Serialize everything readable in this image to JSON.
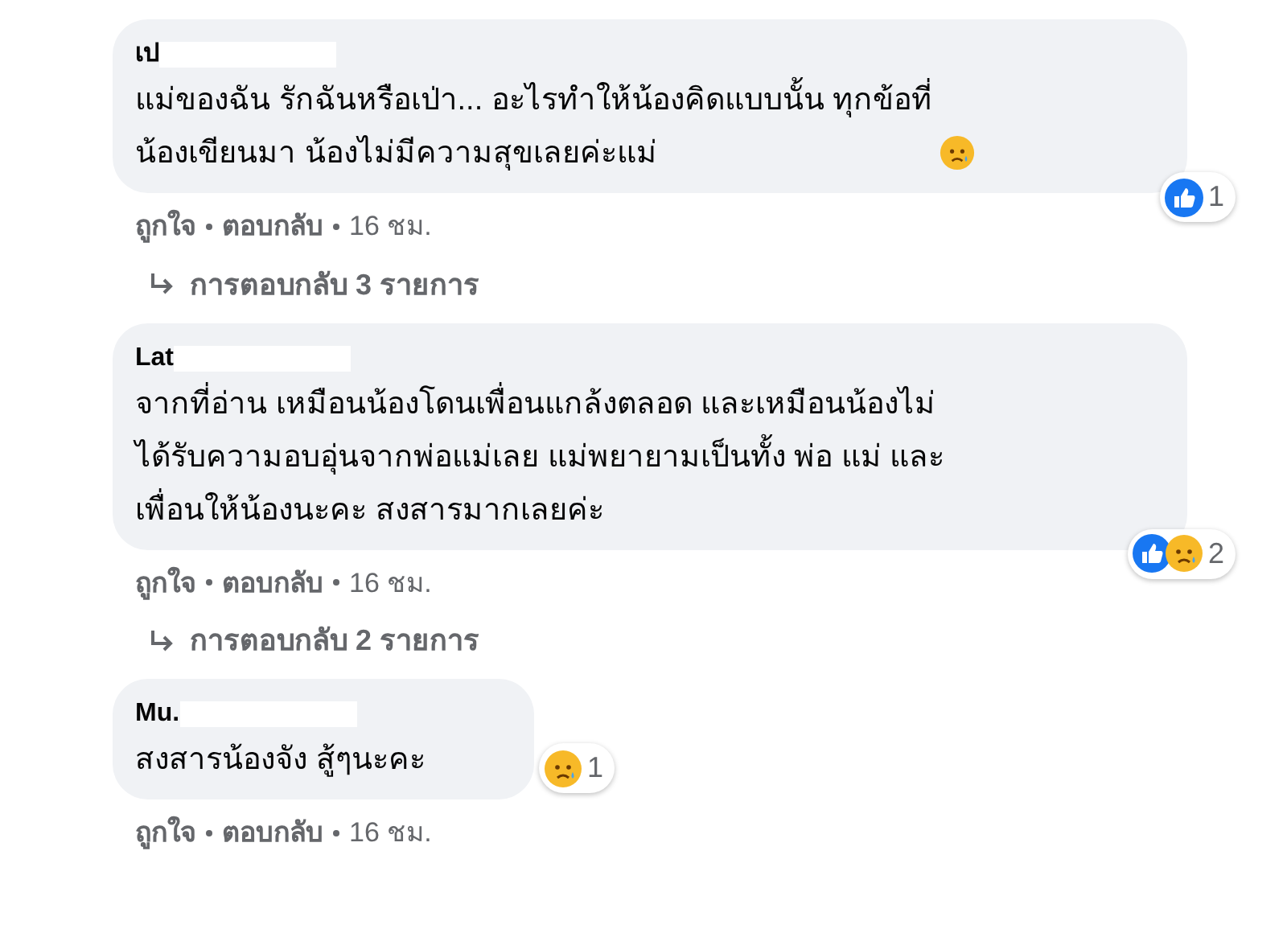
{
  "comments": [
    {
      "author": "เป",
      "text_lines": [
        "แม่ของฉัน รักฉันหรือเป่า... อะไรทำให้น้องคิดแบบนั้น ทุกข้อที่",
        "น้องเขียนมา น้องไม่มีความสุขเลยค่ะแม่"
      ],
      "trailing_emoji": {
        "kind": "sad"
      },
      "reactions": {
        "icons": [
          {
            "kind": "like"
          }
        ],
        "count": "1"
      },
      "actions": [
        "ถูกใจ",
        "ตอบกลับ"
      ],
      "time": "16 ชม.",
      "replies": "การตอบกลับ 3 รายการ"
    },
    {
      "author": "Lat",
      "text_lines": [
        "จากที่อ่าน เหมือนน้องโดนเพื่อนแกล้งตลอด และเหมือนน้องไม่",
        "ได้รับความอบอุ่นจากพ่อแม่เลย แม่พยายามเป็นทั้ง พ่อ แม่ และ",
        "เพื่อนให้น้องนะคะ สงสารมากเลยค่ะ"
      ],
      "reactions": {
        "icons": [
          {
            "kind": "like"
          },
          {
            "kind": "sad"
          }
        ],
        "count": "2"
      },
      "actions": [
        "ถูกใจ",
        "ตอบกลับ"
      ],
      "time": "16 ชม.",
      "replies": "การตอบกลับ 2 รายการ"
    },
    {
      "author": "Mu.",
      "text_lines": [
        "สงสารน้องจัง สู้ๆนะคะ"
      ],
      "reactions": {
        "icons": [
          {
            "kind": "sad"
          }
        ],
        "count": "1"
      },
      "actions": [
        "ถูกใจ",
        "ตอบกลับ"
      ],
      "time": "16 ชม."
    }
  ]
}
